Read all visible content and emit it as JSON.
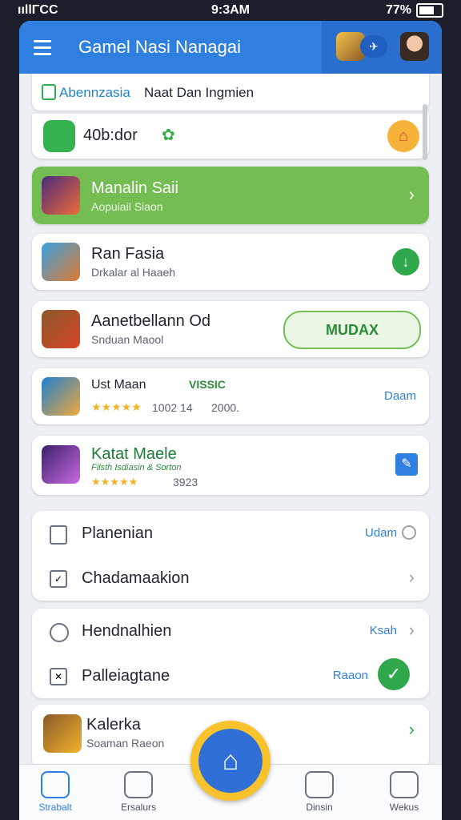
{
  "status": {
    "carrier": "ııllΓCC",
    "time": "9:3AM",
    "battery": "77%"
  },
  "header": {
    "title": "Gamel Nasi Nanagai"
  },
  "banner_top": {
    "label": "Abennzasia",
    "text": "Naat Dan Ingmien"
  },
  "featured": {
    "title": "40b:dor"
  },
  "card_highlight": {
    "title": "Manalin Saii",
    "subtitle": "Aopuiail Siaon"
  },
  "card2": {
    "title": "Ran Fasia",
    "subtitle": "Drkalar al Haaeh"
  },
  "card3": {
    "title": "Aanetbellann Od",
    "subtitle": "Snduan Maool",
    "button": "MUDAX"
  },
  "card4": {
    "title": "Ust Maan",
    "tag": "VISSIC",
    "rating": "1002 14",
    "count": "2000.",
    "action": "Daam"
  },
  "card5": {
    "title": "Katat Maele",
    "sub": "Filsth Isdiasin & Sorton",
    "rating": "3923"
  },
  "settings1": [
    {
      "label": "Planenian",
      "value": "Udam"
    },
    {
      "label": "Chadamaakion",
      "value": ""
    }
  ],
  "settings2": [
    {
      "label": "Hendnalhien",
      "value": "Ksah"
    },
    {
      "label": "Palleiagtane",
      "value": "Raaon"
    }
  ],
  "card6": {
    "title": "Kalerka",
    "subtitle": "Soaman Raeon"
  },
  "nav": [
    {
      "label": "Strabalt"
    },
    {
      "label": "Ersalurs"
    },
    {
      "label": "Dinsin"
    },
    {
      "label": "Wekus"
    }
  ]
}
